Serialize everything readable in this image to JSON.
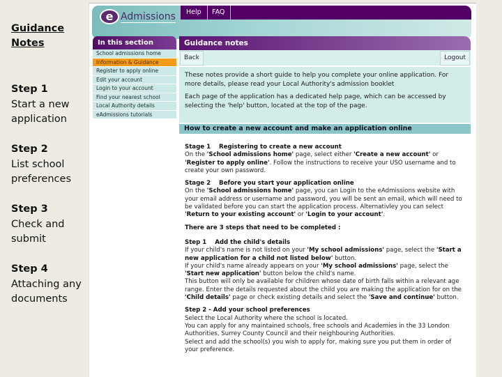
{
  "slide_notes": {
    "title": "Guidance Notes",
    "steps": [
      {
        "label": "Step 1",
        "text": "Start a new application"
      },
      {
        "label": "Step 2",
        "text": "List school preferences"
      },
      {
        "label": "Step 3",
        "text": "Check and submit"
      },
      {
        "label": "Step 4",
        "text": "Attaching any documents"
      }
    ]
  },
  "header": {
    "logo_letter": "e",
    "logo_text": "Admissions",
    "nav": [
      "Help",
      "FAQ"
    ]
  },
  "sidebar": {
    "title": "In this section",
    "items": [
      {
        "label": "School admissions home",
        "active": false
      },
      {
        "label": "Information & Guidance",
        "active": true
      },
      {
        "label": "Register to apply online",
        "active": false
      },
      {
        "label": "Edit your account",
        "active": false
      },
      {
        "label": "Login to your account",
        "active": false
      },
      {
        "label": "Find your nearest school",
        "active": false
      },
      {
        "label": "Local Authority details",
        "active": false
      },
      {
        "label": "eAdmissions tutorials",
        "active": false
      }
    ]
  },
  "main": {
    "title": "Guidance notes",
    "back_label": "Back",
    "logout_label": "Logout",
    "intro_1": "These notes provide a short guide to help you complete your online application. For more details, please read your Local Authority's admission booklet",
    "intro_2": "Each page of the application has a dedicated help page, which can be accessed by selecting the 'help' button, located at the top of the page.",
    "section_title": "How to create a new account and make an application online",
    "stage1": {
      "title": "Stage 1    Registering to create a new account",
      "p1": "On the ",
      "b1": "'School admissions home'",
      "p2": " page, select either ",
      "b2": "'Create a new account'",
      "p3": " or ",
      "b3": "'Register to apply online'",
      "p4": ". Follow the instructions to receive your USO username and to create your own password."
    },
    "stage2": {
      "title": "Stage 2    Before you start your application online",
      "p1": "On the ",
      "b1": "'School admissions home'",
      "p2": " page, you can Login to the eAdmissions website with your email address or username and password, you will be sent an email, which will need to be validated before you can start the application process. Alternativley you can select ",
      "b2": "'Return to your existing account'",
      "p3": " or ",
      "b3": "'Login to your account'",
      "p4": "."
    },
    "steps_intro": "There are 3 steps that need to be completed :",
    "step1": {
      "title": "Step 1    Add the child's details",
      "p1": "If your child's name is not listed on your ",
      "b1": "'My school admissions'",
      "p2": " page, select the ",
      "b2": "'Start a new application for a child not listed below'",
      "p3": " button.",
      "p4": "If your child's name already appears on your ",
      "b3": "'My school admissions'",
      "p5": " page, select the ",
      "b4": "'Start new application'",
      "p6": " button below the child's name.",
      "p7": "This button will only be available for children whose date of birth falls within a relevant age range. Enter the details requested about the child you are making the application for on the ",
      "b5": "'Child details'",
      "p8": " page or check existing details and select the ",
      "b6": "'Save and continue'",
      "p9": " button."
    },
    "step2": {
      "title": "Step 2 - Add your school preferences",
      "l1": "Select the Local Authority where the school is located.",
      "l2": "You can apply for any maintained schools, free schools and Academies in the 33 London Authorities, Surrey County Council and their neighbouring Authorities.",
      "l3": "Select and add the school(s) you wish to apply for, making sure you put them in order of your preference."
    }
  }
}
